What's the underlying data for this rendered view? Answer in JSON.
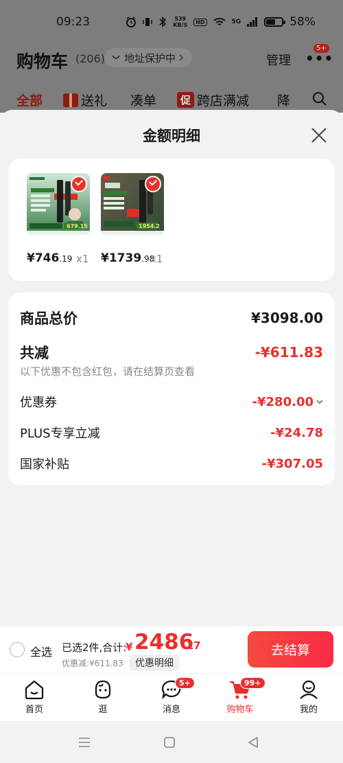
{
  "status_bar": {
    "time": "09:23",
    "net_speed_value": "539",
    "net_speed_unit": "KB/S",
    "hd": "HD",
    "signal_type": "5G",
    "battery_text": "58%",
    "battery_level": 0.58
  },
  "header": {
    "title": "购物车",
    "count": "(206)",
    "address": "地址保护中",
    "manage": "管理",
    "more_badge": "5+"
  },
  "tabs": [
    {
      "label": "全部"
    },
    {
      "label": "送礼"
    },
    {
      "label": "凑单"
    },
    {
      "label": "跨店满减",
      "tag": "促"
    },
    {
      "label": "降"
    }
  ],
  "sheet": {
    "title": "金额明细",
    "products": [
      {
        "price_int": "¥746",
        "price_dec": ".19",
        "qty": "x1",
        "thumb_price": "679.15"
      },
      {
        "price_int": "¥1739",
        "price_dec": ".98",
        "qty": "x1",
        "thumb_price": "1954.2"
      }
    ],
    "summary": {
      "total_label": "商品总价",
      "total_value": "¥3098.00",
      "reduce_label": "共减",
      "reduce_value": "-¥611.83",
      "note": "以下优惠不包含红包，请在结算页查看",
      "items": [
        {
          "label": "优惠券",
          "value": "-¥280.00"
        },
        {
          "label": "PLUS专享立减",
          "value": "-¥24.78"
        },
        {
          "label": "国家补贴",
          "value": "-¥307.05"
        }
      ]
    }
  },
  "checkout": {
    "select_all": "全选",
    "selected_text": "已选2件,合计:",
    "currency": "¥",
    "total_int": "2486",
    "total_dec": ".17",
    "discount_text": "优惠减:¥611.83",
    "detail_chip": "优惠明细",
    "pay_button": "去结算"
  },
  "tabbar": {
    "items": [
      {
        "label": "首页"
      },
      {
        "label": "逛"
      },
      {
        "label": "消息",
        "badge": "5+"
      },
      {
        "label": "购物车",
        "badge": "99+"
      },
      {
        "label": "我的"
      }
    ]
  },
  "colors": {
    "accent": "#e8302e",
    "dim_overlay": "#7d7d7d"
  }
}
